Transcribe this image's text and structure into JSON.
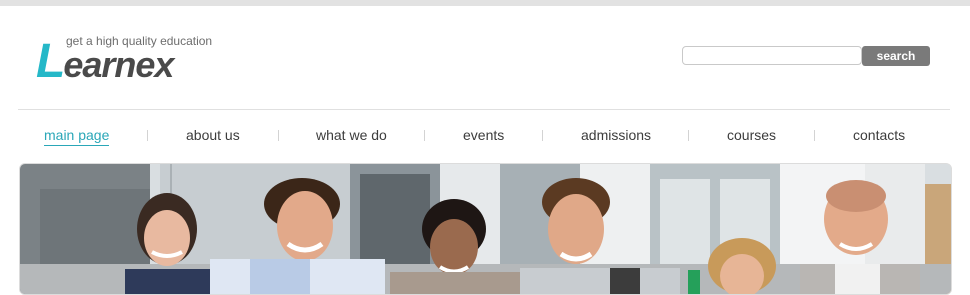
{
  "header": {
    "logo": {
      "tagline": "get a high quality education",
      "first_letter": "L",
      "rest": "earnex"
    },
    "search": {
      "value": "",
      "placeholder": "",
      "button_label": "search"
    }
  },
  "nav": {
    "items": [
      {
        "label": "main page",
        "active": true
      },
      {
        "label": "about us"
      },
      {
        "label": "what we do"
      },
      {
        "label": "events"
      },
      {
        "label": "admissions"
      },
      {
        "label": "courses"
      },
      {
        "label": "contacts"
      }
    ]
  },
  "colors": {
    "accent": "#2aa7b8",
    "logo_teal": "#25b8c8",
    "logo_gray": "#4a4a4a",
    "button": "#7a7a7a",
    "text": "#3c3c3c"
  }
}
